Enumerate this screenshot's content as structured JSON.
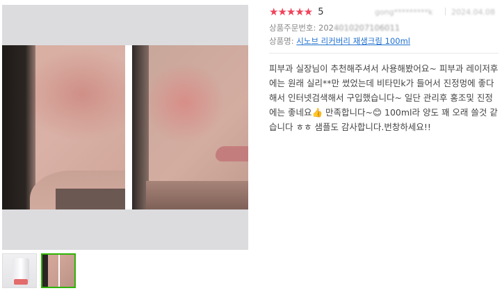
{
  "review": {
    "stars": "★★★★★",
    "score": "5",
    "reviewer_masked": "gong*********k",
    "date_masked": "2024.04.08",
    "order_label": "상품주문번호:",
    "order_number_visible": "202",
    "order_number_masked": "4010207106011",
    "product_label": "상품명:",
    "product_name": "시노브 리커버리 재생크림 100ml",
    "body": "피부과 실장님이 추천해주셔서 사용해봤어요~ 피부과 레이저후에는 원래 실리**만 썼었는데 비타민k가 들어서 진정멍에 좋다해서 인터넷검색해서 구입했습니다~ 일단 관리후 홍조및 진정에는 좋네요👍 만족합니다~😊 100ml라 양도 꽤 오래 쓸것 같습니다 ㅎㅎ 샘플도 감사합니다.번창하세요!!"
  },
  "photos": {
    "main": "face-comparison-photo",
    "thumbnails": [
      "product-bottle-thumbnail",
      "face-comparison-thumbnail"
    ],
    "selected_index": 1
  },
  "colors": {
    "star": "#f0435a",
    "link": "#1e6fcf",
    "selected_border": "#2db400",
    "photo_bg": "#dcdcdf"
  }
}
